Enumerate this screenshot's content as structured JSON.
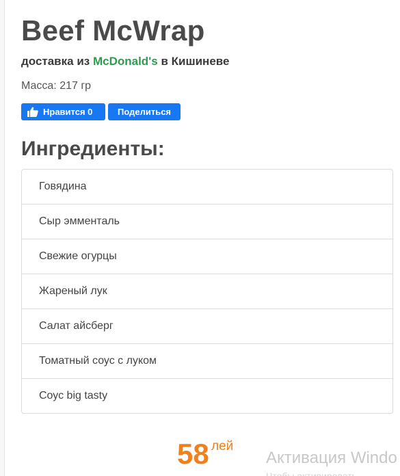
{
  "product": {
    "title": "Beef McWrap",
    "delivery_prefix": "доставка из",
    "delivery_brand": "McDonald's",
    "delivery_suffix": "в Кишиневе",
    "mass": "Масса: 217 гр"
  },
  "social": {
    "like_label": "Нравится 0",
    "share_label": "Поделиться"
  },
  "ingredients": {
    "heading": "Ингредиенты:",
    "items": [
      "Говядина",
      "Сыр эмменталь",
      "Свежие огурцы",
      "Жареный лук",
      "Салат айсберг",
      "Томатный соус с луком",
      "Соус big tasty"
    ]
  },
  "price": {
    "value": "58",
    "currency": "лей"
  },
  "os_watermark": {
    "line1": "Активация Windo",
    "line2": "Чтобы активировать"
  },
  "colors": {
    "brand_green": "#2e9b4e",
    "facebook_blue": "#1877f2",
    "price_orange": "#f07f1d"
  }
}
